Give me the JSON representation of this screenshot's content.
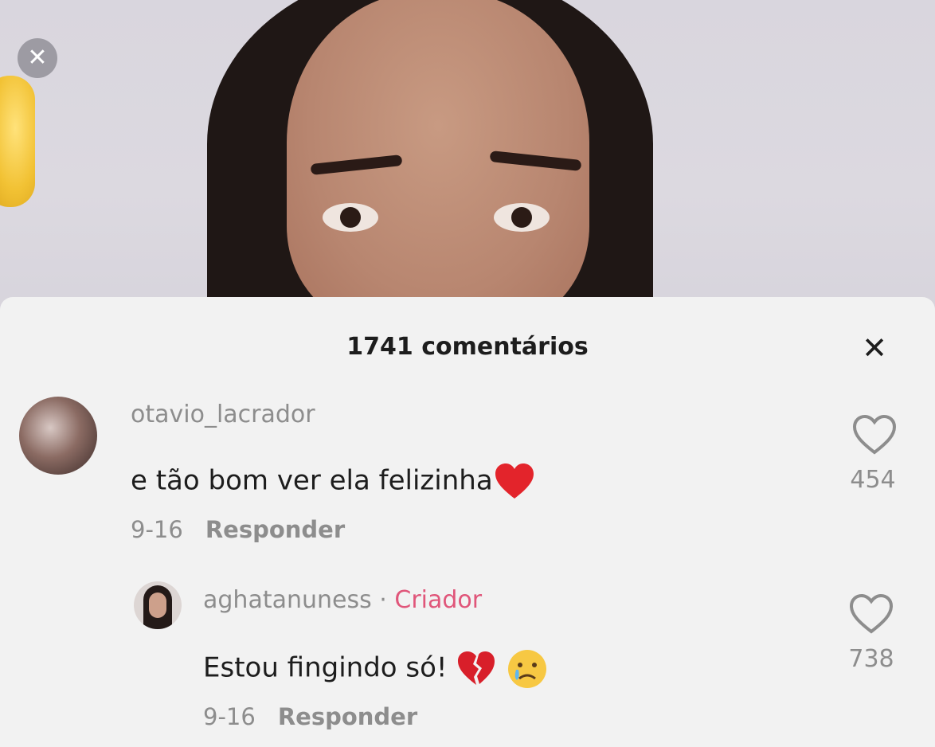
{
  "video": {
    "close_icon": "close-icon"
  },
  "comments_panel": {
    "title": "1741 comentários",
    "close_icon": "close-icon",
    "comments": [
      {
        "username": "otavio_lacrador",
        "text": "e tão bom ver ela felizinha",
        "emoji": "red-heart-emoji",
        "date": "9-16",
        "reply_label": "Responder",
        "likes": "454"
      },
      {
        "username": "aghatanuness",
        "separator": "·",
        "badge": "Criador",
        "text": "Estou fingindo só!",
        "emoji": [
          "broken-heart-emoji",
          "crying-face-emoji"
        ],
        "date": "9-16",
        "reply_label": "Responder",
        "likes": "738"
      }
    ]
  },
  "colors": {
    "panel_bg": "#f2f2f2",
    "text": "#1d1d1d",
    "muted": "#8d8d8d",
    "creator_badge": "#e0567a"
  }
}
